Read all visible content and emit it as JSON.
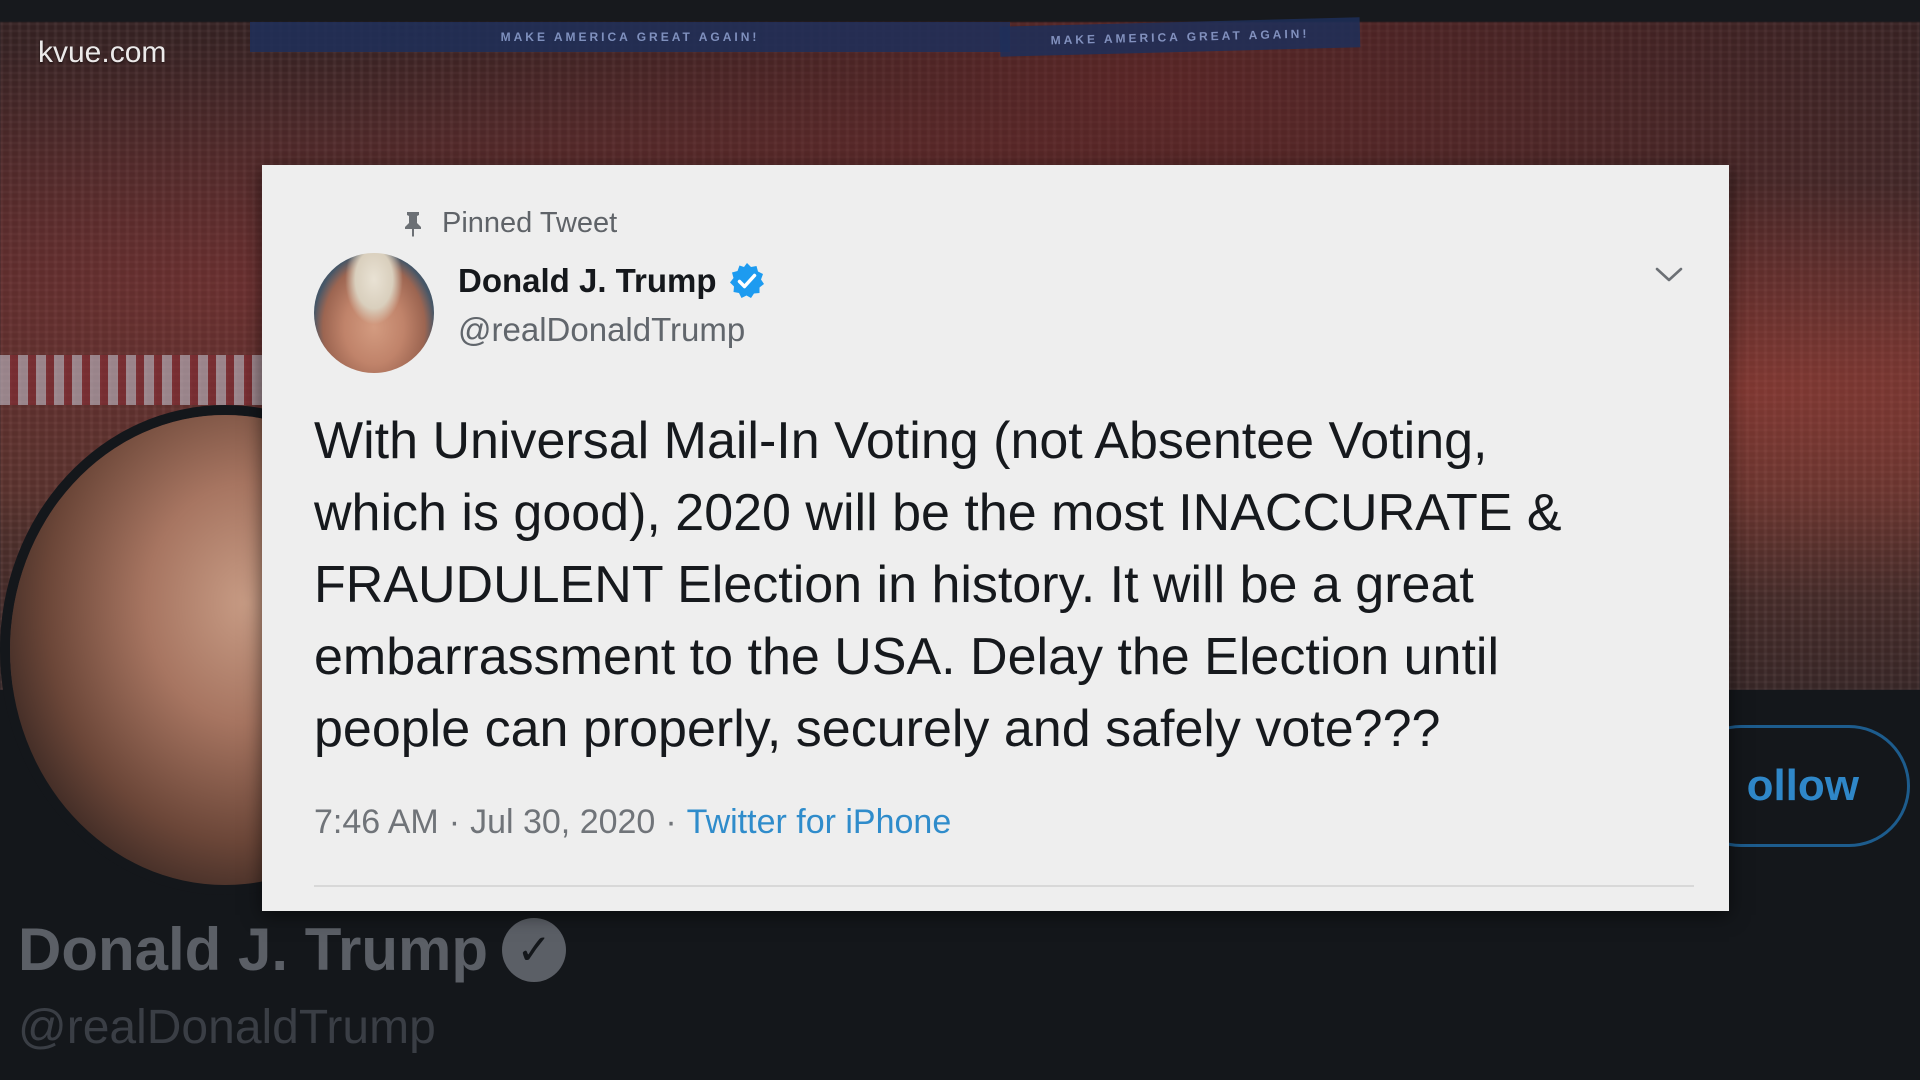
{
  "watermark": "kvue.com",
  "background": {
    "banner_text": "MAKE AMERICA GREAT AGAIN!",
    "name": "Donald J. Trump",
    "handle": "@realDonaldTrump",
    "follow_label": "ollow",
    "verified_glyph": "✓"
  },
  "tweet": {
    "pinned_label": "Pinned Tweet",
    "author_name": "Donald J. Trump",
    "author_handle": "@realDonaldTrump",
    "text": "With Universal Mail-In Voting (not Absentee Voting,\nwhich is good), 2020 will be the most INACCURATE &\nFRAUDULENT Election in history. It will be a great\nembarrassment to the USA. Delay the Election until\npeople can properly, securely and safely vote???",
    "time": "7:46 AM",
    "separator": "·",
    "date": "Jul 30, 2020",
    "source": "Twitter for iPhone"
  },
  "colors": {
    "card_bg": "#eeeeee",
    "verified_blue": "#1d9bf0",
    "link_blue": "#2f8ccb",
    "page_dark": "#14171b"
  },
  "icons": [
    "pin-icon",
    "verified-badge-icon",
    "chevron-down-icon"
  ]
}
